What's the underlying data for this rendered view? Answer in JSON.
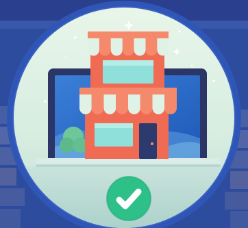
{
  "colors": {
    "background": "#2d4c9e",
    "ring": "#2f56b7",
    "circle_light": "#e4f3e6",
    "circle_mid": "#cbe7d8",
    "laptop_frame": "#2b3566",
    "screen_blue": "#3b7bd6",
    "building": "#f06b54",
    "awning_stripe_light": "#dff3e8",
    "awning_stripe_dark": "#f5896b",
    "window": "#8fe0da",
    "door": "#2d3a6e",
    "check_badge": "#2ec089"
  },
  "icons": {
    "illustration": "storefront-in-laptop-illustration",
    "badge": "check-badge-icon"
  }
}
